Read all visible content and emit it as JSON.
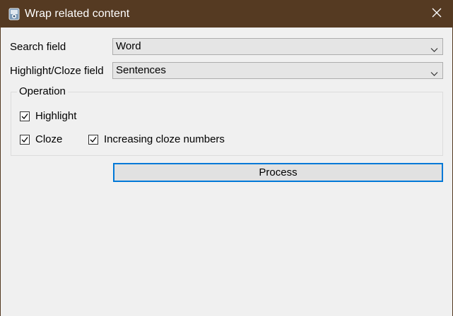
{
  "window": {
    "title": "Wrap related content",
    "app_icon": "app-icon",
    "close_icon": "close-icon",
    "titlebar_color": "#553a22"
  },
  "form": {
    "search_field": {
      "label": "Search field",
      "value": "Word"
    },
    "highlight_field": {
      "label": "Highlight/Cloze field",
      "value": "Sentences"
    }
  },
  "operation": {
    "title": "Operation",
    "highlight": {
      "label": "Highlight",
      "checked": true
    },
    "cloze": {
      "label": "Cloze",
      "checked": true
    },
    "increasing": {
      "label": "Increasing cloze numbers",
      "checked": true
    }
  },
  "actions": {
    "process_label": "Process",
    "accent_color": "#0078d7"
  }
}
